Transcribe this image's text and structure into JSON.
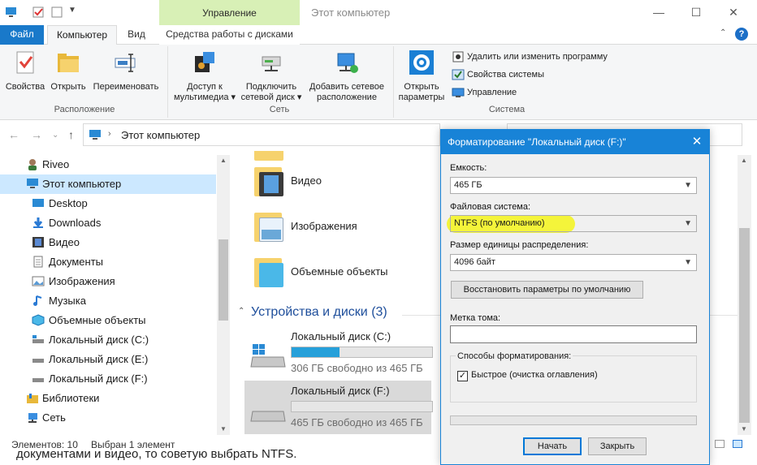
{
  "window": {
    "title": "Этот компьютер",
    "context_tab": "Управление",
    "controls": [
      "—",
      "☐",
      "✕"
    ]
  },
  "ribbon": {
    "tabs": {
      "file": "Файл",
      "computer": "Компьютер",
      "view": "Вид",
      "drive_tools": "Средства работы с дисками"
    },
    "groups": {
      "location": "Расположение",
      "network": "Сеть",
      "system": "Система"
    },
    "buttons": {
      "properties": "Свойства",
      "open": "Открыть",
      "rename": "Переименовать",
      "media_1": "Доступ к",
      "media_2": "мультимедиа",
      "netdrive_1": "Подключить",
      "netdrive_2": "сетевой диск",
      "netloc_1": "Добавить сетевое",
      "netloc_2": "расположение",
      "settings_1": "Открыть",
      "settings_2": "параметры"
    },
    "system_items": {
      "uninstall": "Удалить или изменить программу",
      "sys_props": "Свойства системы",
      "manage": "Управление"
    }
  },
  "address": {
    "path": "Этот компьютер"
  },
  "nav_pane": {
    "items": [
      {
        "label": "Riveo",
        "icon": "user-icon"
      },
      {
        "label": "Этот компьютер",
        "icon": "computer-icon"
      },
      {
        "label": "Desktop",
        "icon": "desktop-icon"
      },
      {
        "label": "Downloads",
        "icon": "download-icon"
      },
      {
        "label": "Видео",
        "icon": "video-icon"
      },
      {
        "label": "Документы",
        "icon": "documents-icon"
      },
      {
        "label": "Изображения",
        "icon": "pictures-icon"
      },
      {
        "label": "Музыка",
        "icon": "music-icon"
      },
      {
        "label": "Объемные объекты",
        "icon": "3d-objects-icon"
      },
      {
        "label": "Локальный диск (C:)",
        "icon": "drive-icon"
      },
      {
        "label": "Локальный диск (E:)",
        "icon": "drive-icon"
      },
      {
        "label": "Локальный диск (F:)",
        "icon": "drive-icon"
      },
      {
        "label": "Библиотеки",
        "icon": "libraries-icon"
      },
      {
        "label": "Сеть",
        "icon": "network-icon"
      }
    ]
  },
  "content": {
    "folders": [
      {
        "label": "Видео"
      },
      {
        "label": "Изображения"
      },
      {
        "label": "Объемные объекты"
      }
    ],
    "section_title": "Устройства и диски (3)",
    "drives": [
      {
        "name": "Локальный диск (C:)",
        "free": "306 ГБ свободно из 465 ГБ",
        "used_fraction": 0.34
      },
      {
        "name": "Локальный диск (F:)",
        "free": "465 ГБ свободно из 465 ГБ",
        "used_fraction": 0.0
      }
    ]
  },
  "status": {
    "count": "Элементов: 10",
    "selected": "Выбран 1 элемент"
  },
  "behind_text": "документами и видео, то советую выбрать NTFS.",
  "dialog": {
    "title": "Форматирование \"Локальный диск (F:)\"",
    "capacity_label": "Емкость:",
    "capacity_value": "465 ГБ",
    "fs_label": "Файловая система:",
    "fs_value": "NTFS (по умолчанию)",
    "alloc_label": "Размер единицы распределения:",
    "alloc_value": "4096 байт",
    "restore_button": "Восстановить параметры по умолчанию",
    "volume_label": "Метка тома:",
    "volume_value": "",
    "options_legend": "Способы форматирования:",
    "quick_label": "Быстрое (очистка оглавления)",
    "quick_checked": true,
    "start_button": "Начать",
    "close_button": "Закрыть",
    "highlight_color": "#f4f43a"
  }
}
